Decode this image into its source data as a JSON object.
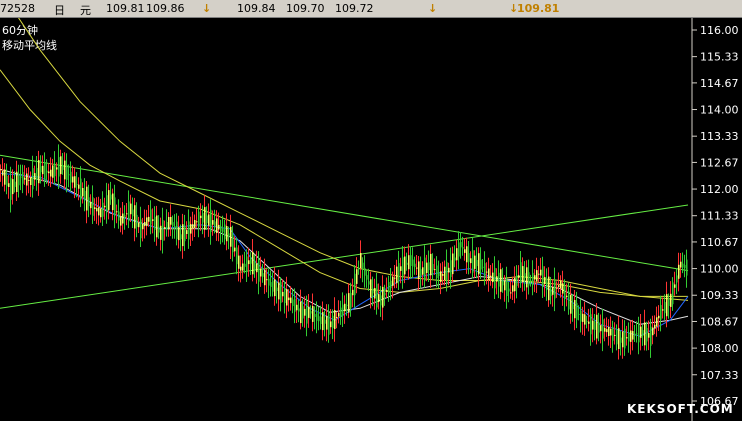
{
  "topbar": {
    "code": "72528",
    "period": "日",
    "unit": "元",
    "open": "109.81",
    "high": "109.86",
    "arrow": "↓",
    "low": "109.84",
    "close": "109.70",
    "last": "109.72",
    "arrow2": "↓",
    "arrow3": "↓",
    "mark_value": "109.81"
  },
  "chart_labels": {
    "period_label": "60分钟",
    "indicator_label": "移动平均线"
  },
  "watermark": "KEKSOFT.COM",
  "colors": {
    "background": "#000000",
    "up_candle": "#ff3333",
    "down_candle": "#33cc33",
    "ma_blue": "#2266ff",
    "ma_white": "#e0e0e0",
    "ma_yellow": "#d8d840",
    "trendline": "#66ee44",
    "axis": "#d4d0c8"
  },
  "chart_data": {
    "type": "line",
    "y_ticks": [
      "116.00",
      "115.33",
      "114.67",
      "114.00",
      "113.33",
      "112.67",
      "112.00",
      "111.33",
      "110.67",
      "110.00",
      "109.33",
      "108.67",
      "108.00",
      "107.33",
      "106.67"
    ],
    "ylim": [
      106.67,
      116.0
    ],
    "price_path": [
      [
        0,
        112.5
      ],
      [
        10,
        112.0
      ],
      [
        20,
        112.3
      ],
      [
        30,
        112.2
      ],
      [
        40,
        112.5
      ],
      [
        50,
        112.4
      ],
      [
        60,
        112.6
      ],
      [
        70,
        112.3
      ],
      [
        80,
        112.0
      ],
      [
        90,
        111.6
      ],
      [
        100,
        111.4
      ],
      [
        110,
        111.8
      ],
      [
        120,
        111.2
      ],
      [
        130,
        111.5
      ],
      [
        140,
        111.0
      ],
      [
        150,
        111.3
      ],
      [
        160,
        110.9
      ],
      [
        170,
        111.2
      ],
      [
        180,
        110.8
      ],
      [
        190,
        111.0
      ],
      [
        200,
        111.3
      ],
      [
        210,
        111.2
      ],
      [
        220,
        111.0
      ],
      [
        230,
        110.8
      ],
      [
        240,
        110.0
      ],
      [
        250,
        110.2
      ],
      [
        260,
        109.9
      ],
      [
        270,
        109.6
      ],
      [
        280,
        109.4
      ],
      [
        290,
        109.2
      ],
      [
        300,
        108.9
      ],
      [
        310,
        108.9
      ],
      [
        320,
        108.7
      ],
      [
        330,
        108.6
      ],
      [
        340,
        108.9
      ],
      [
        350,
        109.2
      ],
      [
        360,
        110.2
      ],
      [
        370,
        109.5
      ],
      [
        380,
        109.2
      ],
      [
        390,
        109.6
      ],
      [
        400,
        110.0
      ],
      [
        410,
        110.2
      ],
      [
        420,
        109.9
      ],
      [
        430,
        110.1
      ],
      [
        440,
        109.8
      ],
      [
        450,
        110.0
      ],
      [
        460,
        110.6
      ],
      [
        470,
        110.2
      ],
      [
        480,
        110.1
      ],
      [
        490,
        109.8
      ],
      [
        500,
        109.7
      ],
      [
        510,
        109.4
      ],
      [
        520,
        109.9
      ],
      [
        530,
        109.7
      ],
      [
        540,
        109.9
      ],
      [
        550,
        109.4
      ],
      [
        560,
        109.6
      ],
      [
        570,
        109.1
      ],
      [
        580,
        108.8
      ],
      [
        590,
        108.6
      ],
      [
        600,
        108.5
      ],
      [
        610,
        108.4
      ],
      [
        620,
        108.2
      ],
      [
        630,
        108.3
      ],
      [
        640,
        108.4
      ],
      [
        650,
        108.3
      ],
      [
        660,
        108.9
      ],
      [
        670,
        109.2
      ],
      [
        680,
        110.1
      ],
      [
        688,
        110.0
      ]
    ],
    "ma_short": [
      [
        0,
        112.4
      ],
      [
        40,
        112.3
      ],
      [
        80,
        111.8
      ],
      [
        120,
        111.3
      ],
      [
        160,
        111.0
      ],
      [
        200,
        111.1
      ],
      [
        230,
        111.0
      ],
      [
        250,
        110.3
      ],
      [
        280,
        109.6
      ],
      [
        310,
        109.0
      ],
      [
        335,
        108.7
      ],
      [
        360,
        109.1
      ],
      [
        400,
        109.7
      ],
      [
        440,
        109.9
      ],
      [
        470,
        110.0
      ],
      [
        500,
        109.7
      ],
      [
        540,
        109.6
      ],
      [
        570,
        109.2
      ],
      [
        600,
        108.6
      ],
      [
        640,
        108.3
      ],
      [
        670,
        108.7
      ],
      [
        688,
        109.3
      ]
    ],
    "ma_mid": [
      [
        0,
        112.5
      ],
      [
        60,
        112.1
      ],
      [
        110,
        111.4
      ],
      [
        160,
        111.0
      ],
      [
        210,
        111.0
      ],
      [
        240,
        110.7
      ],
      [
        270,
        110.0
      ],
      [
        300,
        109.3
      ],
      [
        330,
        108.9
      ],
      [
        360,
        109.0
      ],
      [
        400,
        109.4
      ],
      [
        440,
        109.6
      ],
      [
        480,
        109.8
      ],
      [
        520,
        109.7
      ],
      [
        560,
        109.5
      ],
      [
        600,
        109.0
      ],
      [
        640,
        108.6
      ],
      [
        670,
        108.7
      ],
      [
        688,
        108.8
      ]
    ],
    "ma_long": [
      [
        0,
        115.0
      ],
      [
        30,
        114.0
      ],
      [
        60,
        113.2
      ],
      [
        90,
        112.6
      ],
      [
        120,
        112.2
      ],
      [
        160,
        111.7
      ],
      [
        200,
        111.5
      ],
      [
        240,
        111.1
      ],
      [
        280,
        110.5
      ],
      [
        320,
        109.9
      ],
      [
        360,
        109.5
      ],
      [
        400,
        109.4
      ],
      [
        440,
        109.5
      ],
      [
        480,
        109.7
      ],
      [
        520,
        109.8
      ],
      [
        560,
        109.7
      ],
      [
        600,
        109.5
      ],
      [
        640,
        109.3
      ],
      [
        688,
        109.2
      ]
    ],
    "ma_very_long": [
      [
        0,
        117.0
      ],
      [
        40,
        115.5
      ],
      [
        80,
        114.2
      ],
      [
        120,
        113.2
      ],
      [
        160,
        112.4
      ],
      [
        200,
        111.9
      ],
      [
        240,
        111.4
      ],
      [
        280,
        110.9
      ],
      [
        320,
        110.4
      ],
      [
        360,
        110.0
      ],
      [
        400,
        109.8
      ],
      [
        440,
        109.7
      ],
      [
        480,
        109.7
      ],
      [
        520,
        109.7
      ],
      [
        560,
        109.6
      ],
      [
        600,
        109.4
      ],
      [
        640,
        109.3
      ],
      [
        688,
        109.3
      ]
    ],
    "trend_down": [
      [
        0,
        112.85
      ],
      [
        688,
        109.95
      ]
    ],
    "trend_up": [
      [
        0,
        109.0
      ],
      [
        688,
        111.6
      ]
    ]
  }
}
